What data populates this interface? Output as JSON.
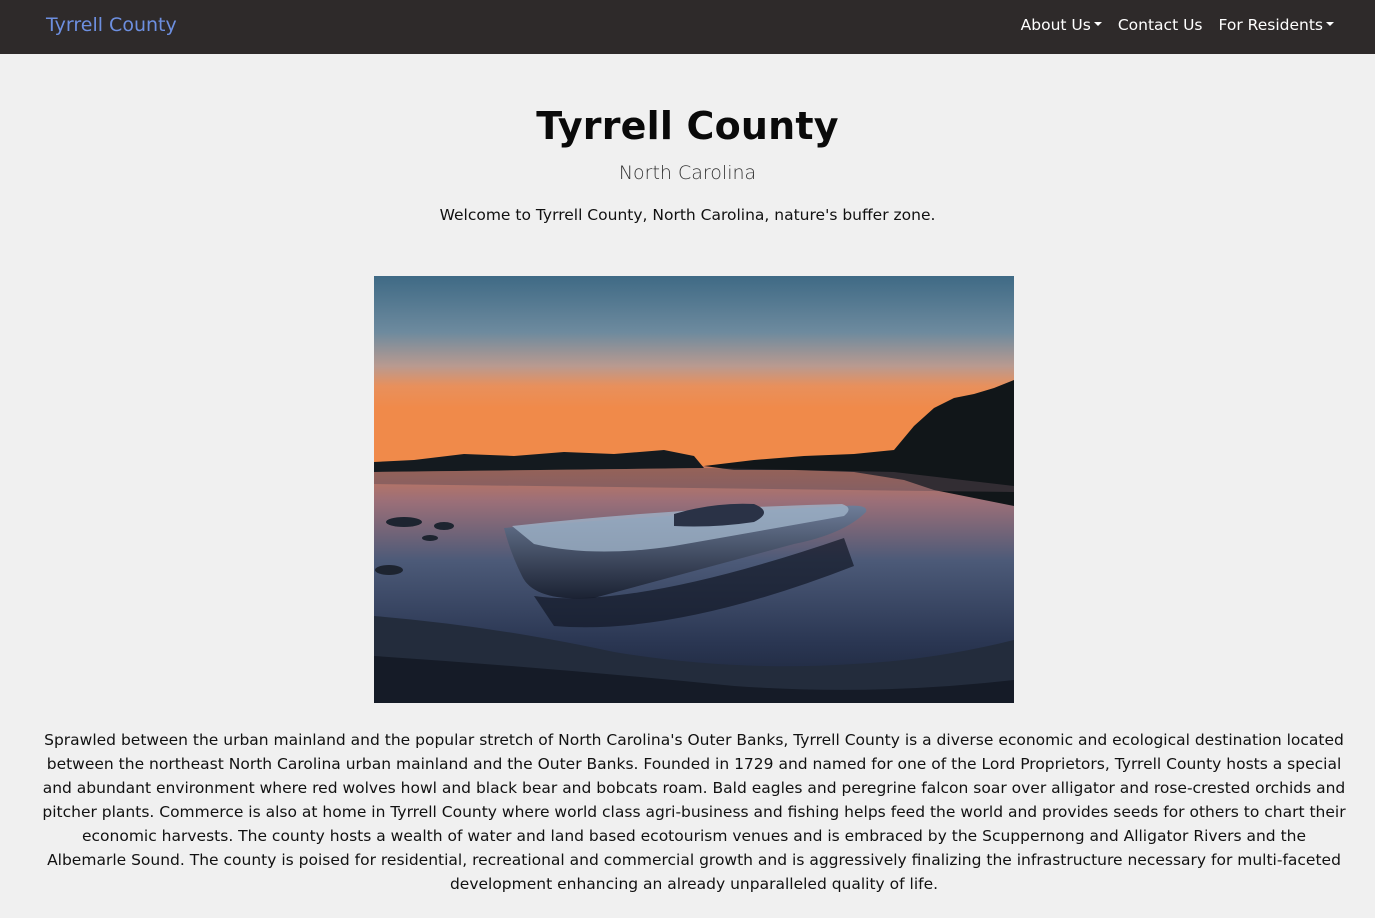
{
  "navbar": {
    "brand": "Tyrrell County",
    "links": [
      {
        "label": "About Us",
        "dropdown": true
      },
      {
        "label": "Contact Us",
        "dropdown": false
      },
      {
        "label": "For Residents",
        "dropdown": true
      }
    ]
  },
  "hero": {
    "title": "Tyrrell County",
    "subtitle": "North Carolina",
    "welcome": "Welcome to Tyrrell County, North Carolina, nature's buffer zone."
  },
  "main": {
    "description": "Sprawled between the urban mainland and the popular stretch of North Carolina's Outer Banks, Tyrrell County is a diverse economic and ecological destination located between the northeast North Carolina urban mainland and the Outer Banks. Founded in 1729 and named for one of the Lord Proprietors, Tyrrell County hosts a special and abundant environment where red wolves howl and black bear and bobcats roam. Bald eagles and peregrine falcon soar over alligator and rose-crested orchids and pitcher plants. Commerce is also at home in Tyrrell County where world class agri-business and fishing helps feed the world and provides seeds for others to chart their economic harvests. The county hosts a wealth of water and land based ecotourism venues and is embraced by the Scuppernong and Alligator Rivers and the Albemarle Sound. The county is poised for residential, recreational and commercial growth and is aggressively finalizing the infrastructure necessary for multi-faceted development enhancing an already unparalleled quality of life."
  },
  "colors": {
    "navbar_bg": "#2e2a2a",
    "brand": "#6d8fe0",
    "page_bg": "#f0f0f0"
  }
}
